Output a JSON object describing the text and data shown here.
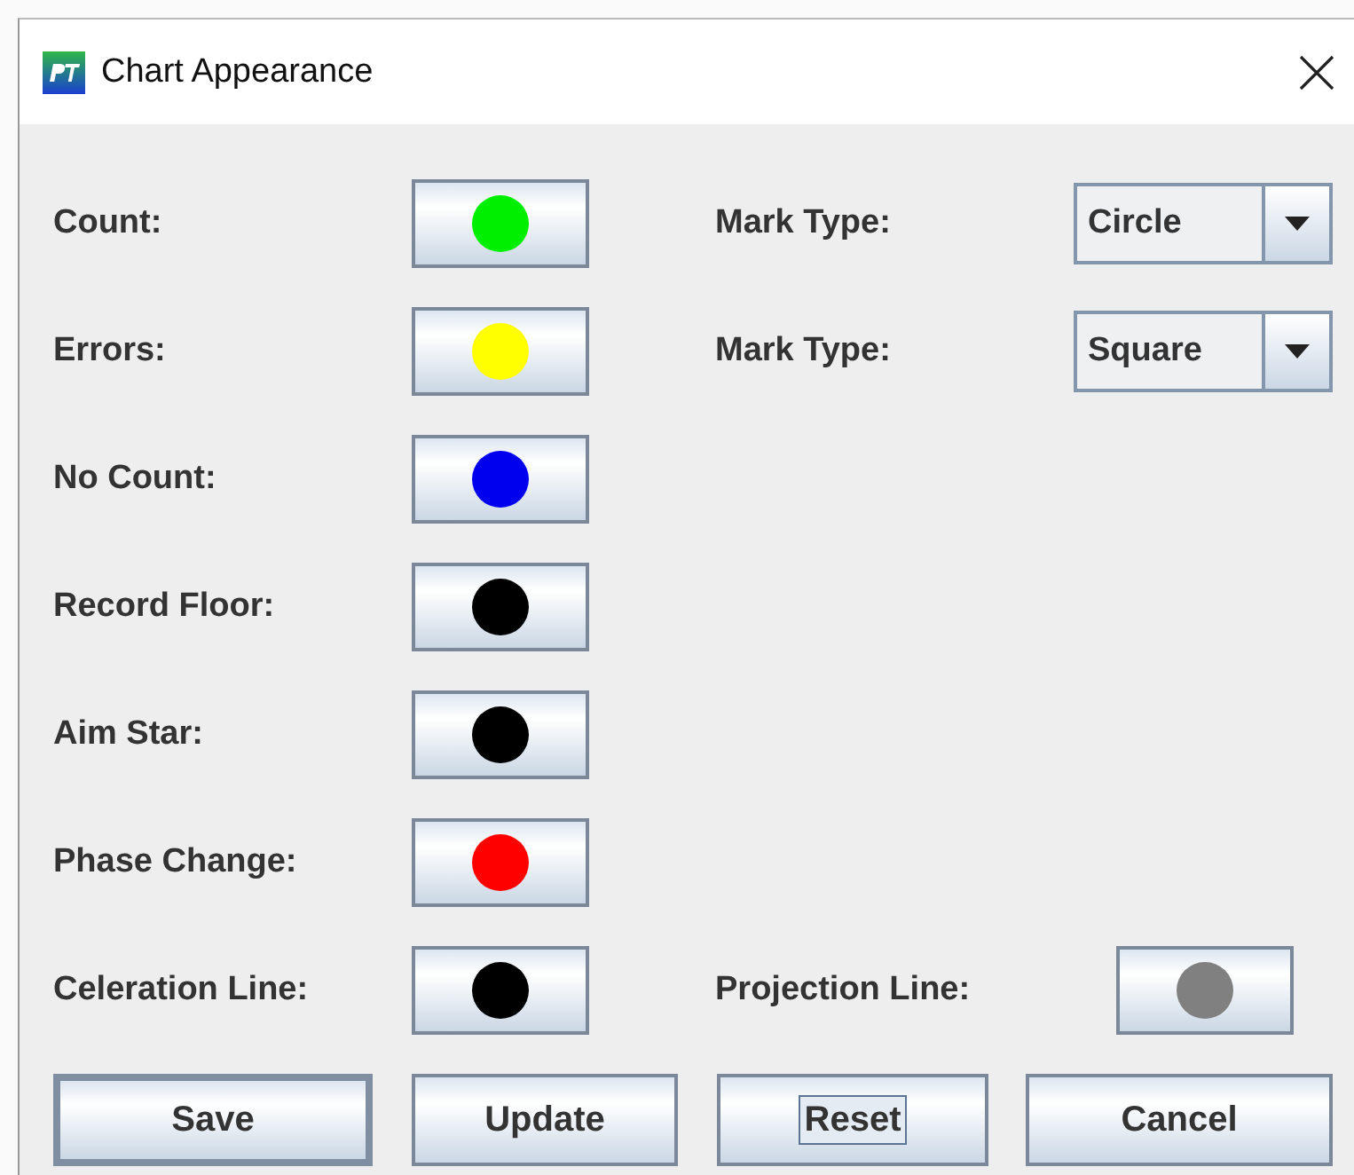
{
  "window": {
    "title": "Chart Appearance"
  },
  "rows": [
    {
      "label": "Count:",
      "color": "#00ee00",
      "right": {
        "kind": "combo",
        "label": "Mark Type:",
        "value": "Circle"
      }
    },
    {
      "label": "Errors:",
      "color": "#ffff00",
      "right": {
        "kind": "combo",
        "label": "Mark Type:",
        "value": "Square"
      }
    },
    {
      "label": "No Count:",
      "color": "#0000ee"
    },
    {
      "label": "Record Floor:",
      "color": "#000000"
    },
    {
      "label": "Aim Star:",
      "color": "#000000"
    },
    {
      "label": "Phase Change:",
      "color": "#ff0000"
    },
    {
      "label": "Celeration Line:",
      "color": "#000000",
      "right": {
        "kind": "color",
        "label": "Projection Line:",
        "color": "#808080"
      }
    }
  ],
  "buttons": [
    {
      "label": "Save",
      "default": true,
      "focused": false
    },
    {
      "label": "Update",
      "default": false,
      "focused": false
    },
    {
      "label": "Reset",
      "default": false,
      "focused": true
    },
    {
      "label": "Cancel",
      "default": false,
      "focused": false
    }
  ]
}
